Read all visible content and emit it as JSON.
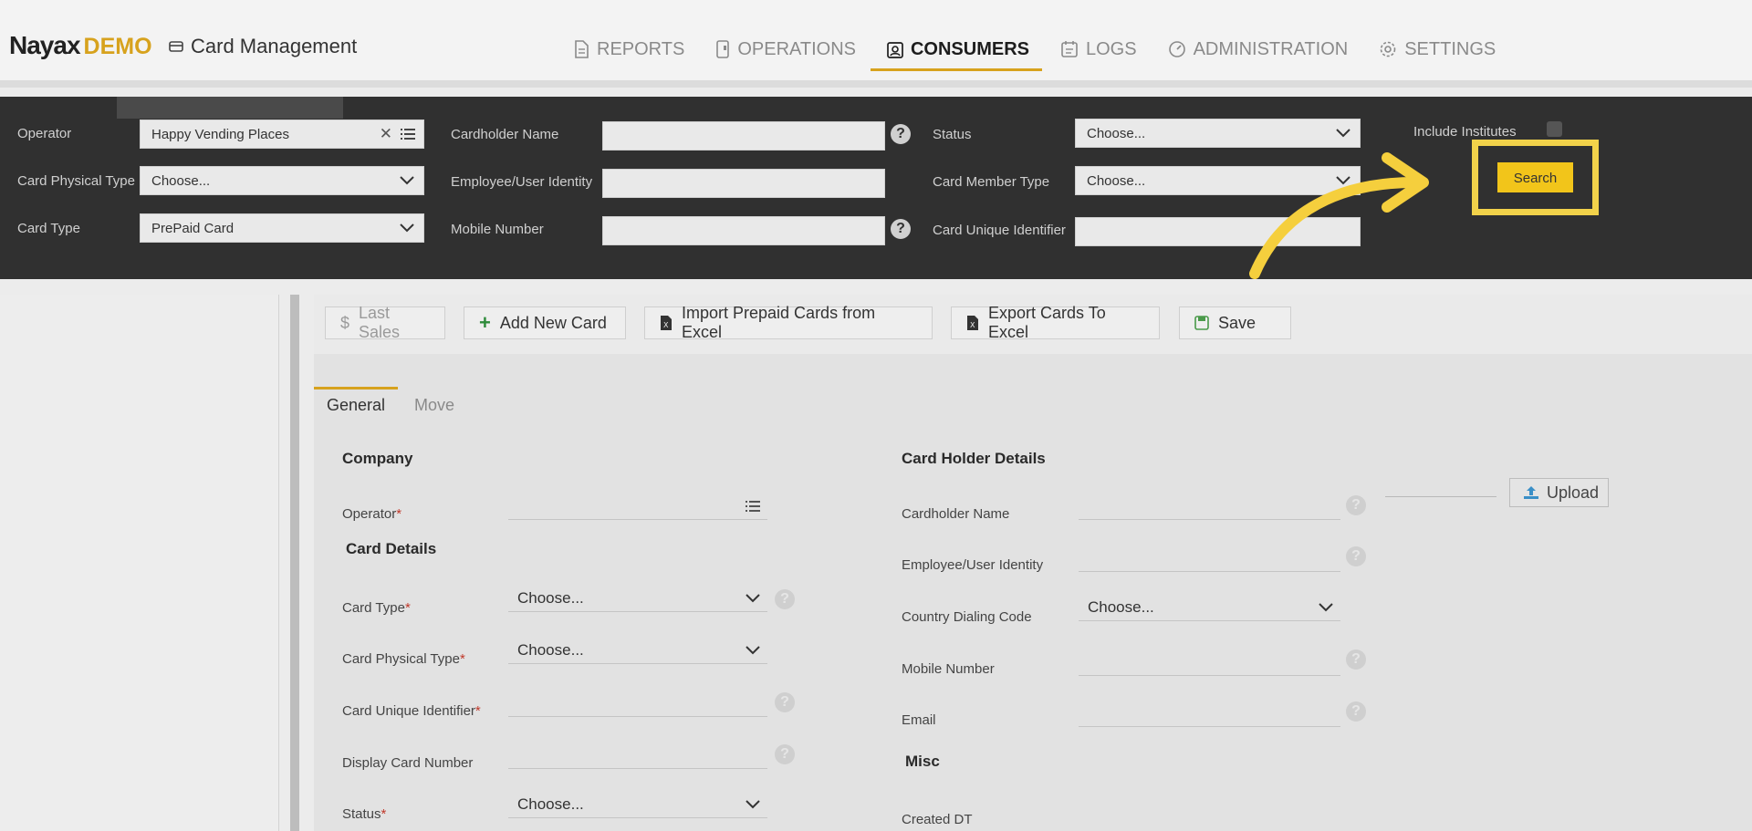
{
  "header": {
    "logo_main": "Nayax",
    "logo_suffix": "DEMO",
    "app_title": "Card Management",
    "nav": [
      {
        "label": "REPORTS",
        "icon": "document-icon"
      },
      {
        "label": "OPERATIONS",
        "icon": "device-icon"
      },
      {
        "label": "CONSUMERS",
        "icon": "id-badge-icon",
        "active": true
      },
      {
        "label": "LOGS",
        "icon": "calendar-icon"
      },
      {
        "label": "ADMINISTRATION",
        "icon": "gauge-icon"
      },
      {
        "label": "SETTINGS",
        "icon": "gear-icon"
      }
    ]
  },
  "filters": {
    "operator_label": "Operator",
    "operator_value": "Happy Vending Places",
    "card_physical_type_label": "Card Physical Type",
    "card_physical_type_value": "Choose...",
    "card_type_label": "Card Type",
    "card_type_value": "PrePaid Card",
    "cardholder_name_label": "Cardholder Name",
    "employee_identity_label": "Employee/User Identity",
    "mobile_number_label": "Mobile Number",
    "status_label": "Status",
    "status_value": "Choose...",
    "card_member_type_label": "Card Member Type",
    "card_member_type_value": "Choose...",
    "card_unique_identifier_label": "Card Unique Identifier",
    "include_institutes_label": "Include Institutes",
    "search_label": "Search",
    "help_glyph": "?"
  },
  "toolbar": {
    "last_sales": "Last Sales",
    "add_new_card": "Add New Card",
    "import_prepaid": "Import Prepaid Cards from Excel",
    "export_cards": "Export Cards To Excel",
    "save": "Save"
  },
  "tabs": {
    "general": "General",
    "move": "Move"
  },
  "form": {
    "company_section": "Company",
    "operator_label": "Operator",
    "card_details_section": "Card Details",
    "card_type_label": "Card Type",
    "card_type_value": "Choose...",
    "card_physical_type_label": "Card Physical Type",
    "card_physical_type_value": "Choose...",
    "card_unique_identifier_label": "Card Unique Identifier",
    "display_card_number_label": "Display Card Number",
    "status_label": "Status",
    "status_value": "Choose...",
    "card_holder_section": "Card Holder Details",
    "cardholder_name_label": "Cardholder Name",
    "employee_identity_label": "Employee/User Identity",
    "country_dialing_code_label": "Country Dialing Code",
    "country_dialing_code_value": "Choose...",
    "mobile_number_label": "Mobile Number",
    "email_label": "Email",
    "misc_section": "Misc",
    "created_dt_label": "Created DT",
    "upload_label": "Upload",
    "required_mark": "*"
  },
  "colors": {
    "accent": "#f2c51a",
    "brand": "#d7a21d",
    "filter_bar": "#303030"
  }
}
